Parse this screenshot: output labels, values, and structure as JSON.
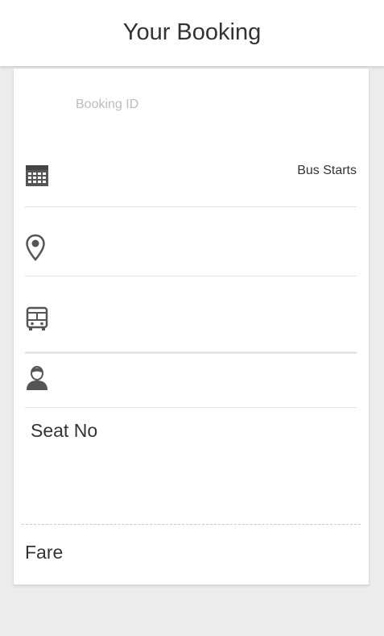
{
  "header": {
    "title": "Your Booking"
  },
  "booking": {
    "booking_id_label": "Booking ID",
    "bus_starts_label": "Bus Starts",
    "seat_label": "Seat No",
    "fare_label": "Fare"
  },
  "icons": {
    "date": "calendar-icon",
    "location": "location-pin-icon",
    "bus": "bus-icon",
    "passenger": "user-icon"
  },
  "colors": {
    "icon": "#555555",
    "placeholder_text": "#bdbdbd",
    "background": "#ececec"
  }
}
